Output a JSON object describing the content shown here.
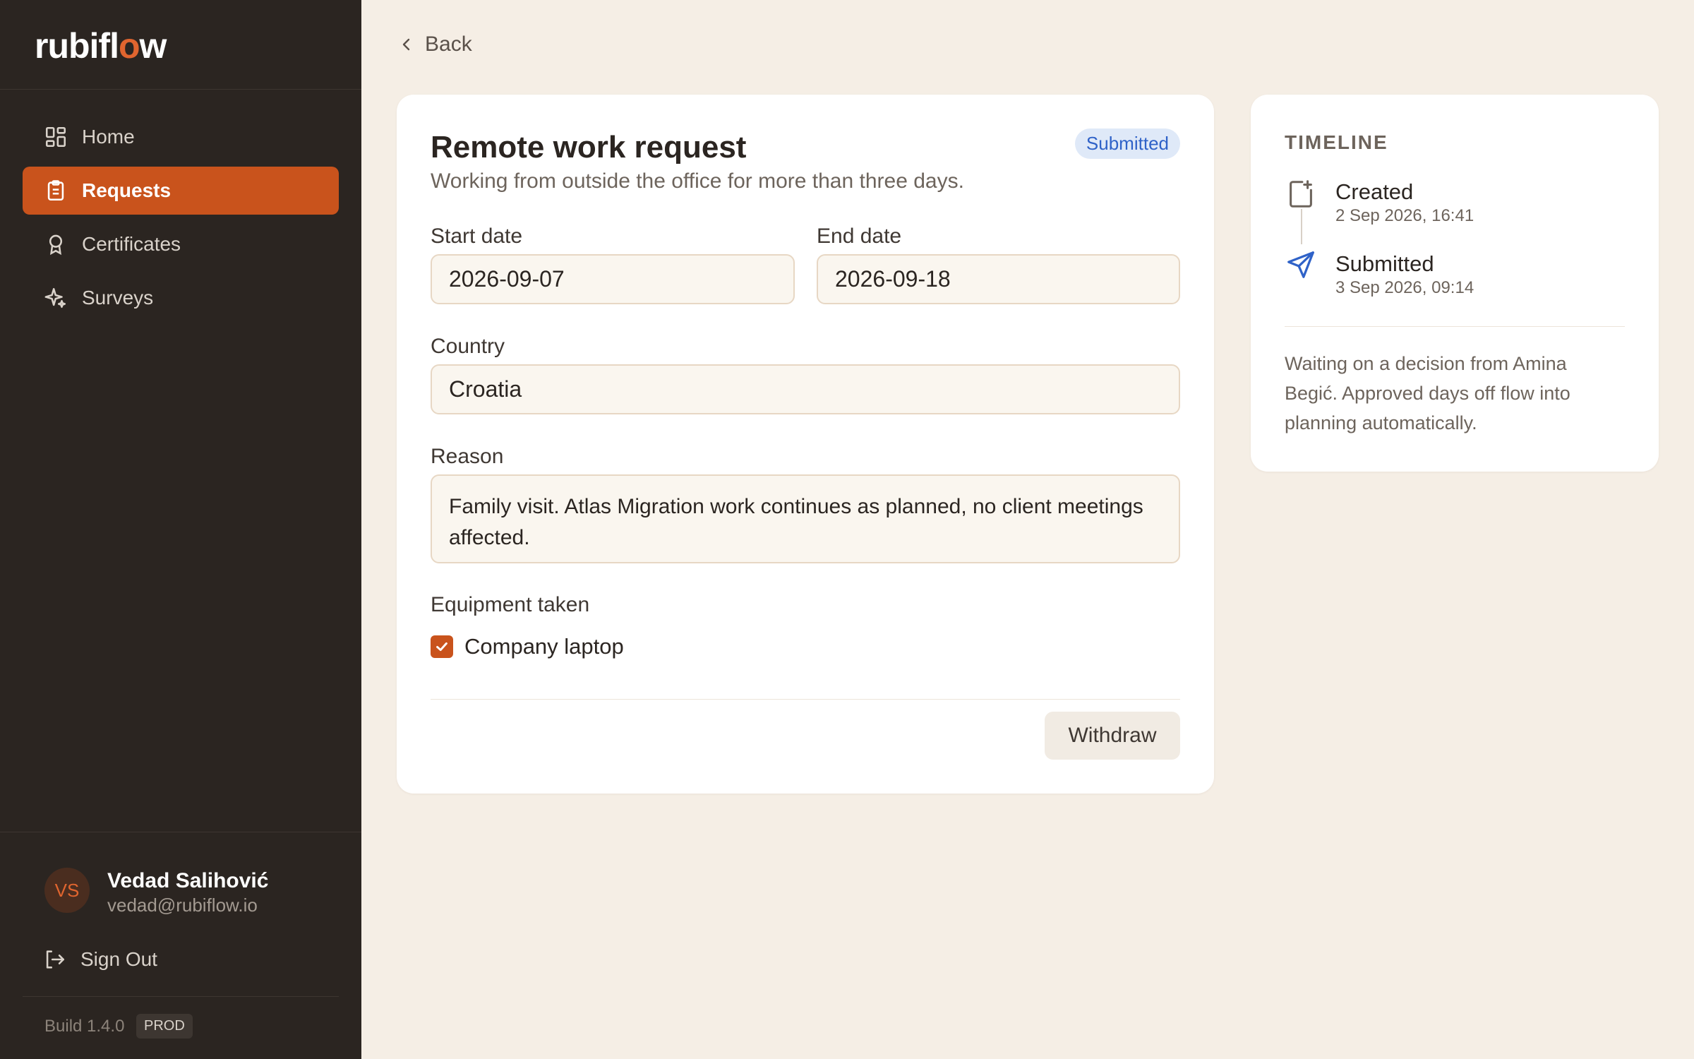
{
  "brand": {
    "logo_pre": "rubifl",
    "logo_o": "o",
    "logo_post": "w",
    "accent_color": "#c9531c"
  },
  "sidebar": {
    "items": [
      {
        "label": "Home",
        "icon": "grid-icon",
        "active": false
      },
      {
        "label": "Requests",
        "icon": "clipboard-icon",
        "active": true
      },
      {
        "label": "Certificates",
        "icon": "award-icon",
        "active": false
      },
      {
        "label": "Surveys",
        "icon": "sparkle-icon",
        "active": false
      }
    ],
    "user": {
      "initials": "VS",
      "name": "Vedad Salihović",
      "email": "vedad@rubiflow.io"
    },
    "sign_out": "Sign Out",
    "build": "Build 1.4.0",
    "env": "PROD"
  },
  "back_label": "Back",
  "request": {
    "title": "Remote work request",
    "subtitle": "Working from outside the office for more than three days.",
    "status": "Submitted",
    "status_color": "#2f62c8",
    "start_date_label": "Start date",
    "start_date": "2026-09-07",
    "end_date_label": "End date",
    "end_date": "2026-09-18",
    "country_label": "Country",
    "country": "Croatia",
    "reason_label": "Reason",
    "reason": "Family visit. Atlas Migration work continues as planned, no client meetings affected.",
    "equipment_label": "Equipment taken",
    "equipment": [
      {
        "label": "Company laptop",
        "checked": true
      }
    ],
    "withdraw_label": "Withdraw"
  },
  "timeline": {
    "heading": "TIMELINE",
    "events": [
      {
        "title": "Created",
        "time": "2 Sep 2026, 16:41",
        "icon": "file-plus-icon"
      },
      {
        "title": "Submitted",
        "time": "3 Sep 2026, 09:14",
        "icon": "send-icon"
      }
    ],
    "note": "Waiting on a decision from Amina Begić. Approved days off flow into planning automatically."
  }
}
